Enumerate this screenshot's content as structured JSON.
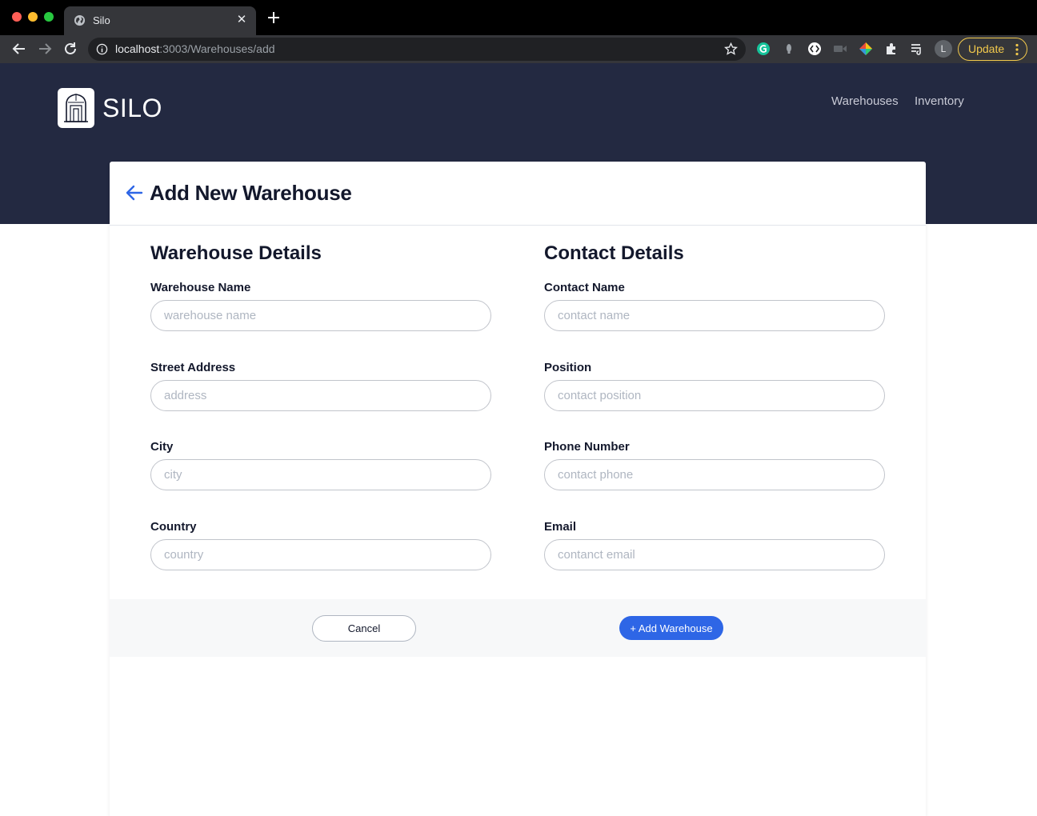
{
  "browser": {
    "tab_title": "Silo",
    "url_host": "localhost",
    "url_path": ":3003/Warehouses/add",
    "profile_initial": "L",
    "update_label": "Update",
    "update_color": "#f2c94c"
  },
  "app": {
    "logo_text": "SILO",
    "nav": {
      "warehouses": "Warehouses",
      "inventory": "Inventory"
    },
    "header_color": "#232941",
    "accent_color": "#2e66e6"
  },
  "page": {
    "title": "Add New Warehouse"
  },
  "warehouse_details": {
    "heading": "Warehouse Details",
    "fields": [
      {
        "label": "Warehouse Name",
        "placeholder": "warehouse name",
        "value": ""
      },
      {
        "label": "Street Address",
        "placeholder": "address",
        "value": ""
      },
      {
        "label": "City",
        "placeholder": "city",
        "value": ""
      },
      {
        "label": "Country",
        "placeholder": "country",
        "value": ""
      }
    ]
  },
  "contact_details": {
    "heading": "Contact Details",
    "fields": [
      {
        "label": "Contact Name",
        "placeholder": "contact name",
        "value": ""
      },
      {
        "label": "Position",
        "placeholder": "contact position",
        "value": ""
      },
      {
        "label": "Phone Number",
        "placeholder": "contact phone",
        "value": ""
      },
      {
        "label": "Email",
        "placeholder": "contanct email",
        "value": ""
      }
    ]
  },
  "actions": {
    "cancel_label": "Cancel",
    "add_label": "+ Add Warehouse"
  }
}
